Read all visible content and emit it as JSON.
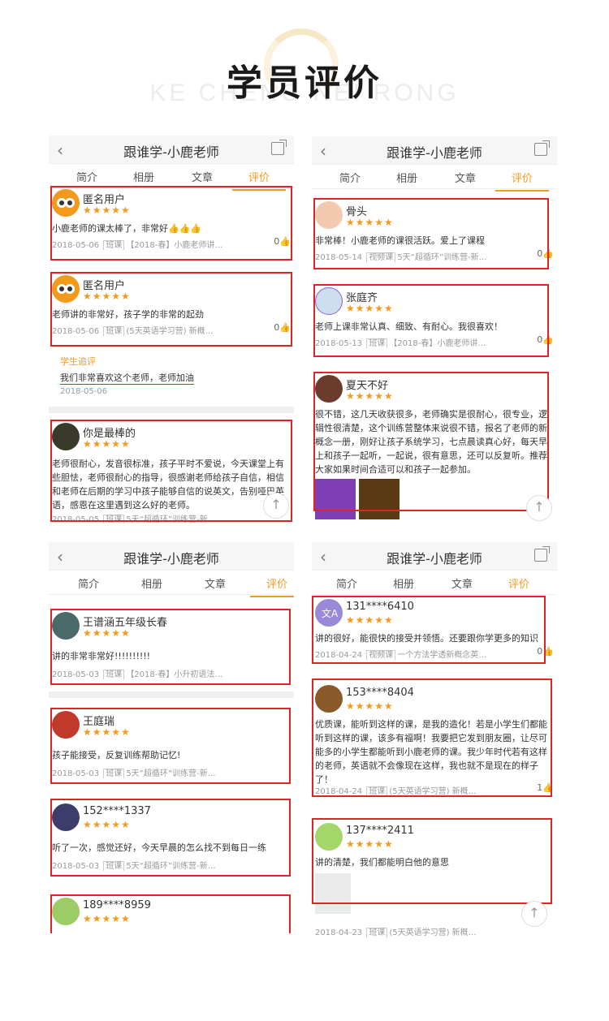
{
  "header": {
    "title": "学员评价",
    "bg_text": "KE CHENG NEI RONG"
  },
  "nav_title": "跟谁学-小鹿老师",
  "tabs": [
    "简介",
    "相册",
    "文章",
    "评价"
  ],
  "colors": {
    "accent": "#f39a1d",
    "highlight": "#e02424"
  },
  "panels": {
    "tl": {
      "reviews": [
        {
          "user": "匿名用户",
          "stars": "★★★★★",
          "text": "小鹿老师的课太棒了，非常好👍👍👍",
          "date": "2018-05-06",
          "tag": "班课",
          "course": "【2018-春】小鹿老师讲…",
          "likes": "0"
        },
        {
          "user": "匿名用户",
          "stars": "★★★★★",
          "text": "老师讲的非常好，孩子学的非常的起劲",
          "date": "2018-05-06",
          "tag": "班课",
          "course": "(5天英语学习营) 新概…",
          "likes": "0"
        },
        {
          "user": "你是最棒的",
          "stars": "★★★★★",
          "text": "老师很耐心，发音很标准，孩子平时不爱说，今天课堂上有些胆怯，老师很耐心的指导，很感谢老师给孩子自信，相信和老师在后期的学习中孩子能够自信的说英文，告别哑巴英语，感恩在这里遇到这么好的老师。",
          "date": "2018-05-05",
          "tag": "班课",
          "course": "5天“超循环”训练营-新…",
          "likes": ""
        }
      ],
      "followup": {
        "label": "学生追评",
        "text": "我们非常喜欢这个老师，老师加油",
        "date": "2018-05-06"
      }
    },
    "tr": {
      "reviews": [
        {
          "user": "骨头",
          "stars": "★★★★★",
          "text": "非常棒！小鹿老师的课很活跃。爱上了课程",
          "date": "2018-05-14",
          "tag": "视频课",
          "course": "5天“超循环”训练营-新…",
          "likes": "0"
        },
        {
          "user": "张庭齐",
          "stars": "★★★★★",
          "text": "老师上课非常认真、细致、有耐心。我很喜欢！",
          "date": "2018-05-13",
          "tag": "班课",
          "course": "【2018-春】小鹿老师讲…",
          "likes": "0"
        },
        {
          "user": "夏天不好",
          "stars": "★★★★★",
          "text": "很不错，这几天收获很多，老师确实是很耐心，很专业，逻辑性很清楚，这个训练营整体来说很不错，报名了老师的新概念一册，刚好让孩子系统学习，七点晨读真心好，每天早上和孩子一起听，一起说，很有意思，还可以反复听。推荐大家如果时间合适可以和孩子一起参加。",
          "date": "",
          "tag": "",
          "course": "",
          "likes": ""
        }
      ]
    },
    "bl": {
      "reviews": [
        {
          "user": "王谱涵五年级长春",
          "stars": "★★★★★",
          "text": "讲的非常非常好!!!!!!!!!!",
          "date": "2018-05-03",
          "tag": "班课",
          "course": "【2018-春】小升初语法…",
          "likes": ""
        },
        {
          "user": "王庭瑞",
          "stars": "★★★★★",
          "text": "孩子能接受，反复训练帮助记忆!",
          "date": "2018-05-03",
          "tag": "班课",
          "course": "5天“超循环”训练营-新…",
          "likes": ""
        },
        {
          "user": "152****1337",
          "stars": "★★★★★",
          "text": "听了一次，感觉还好，今天早晨的怎么找不到每日一练",
          "date": "2018-05-03",
          "tag": "班课",
          "course": "5天“超循环”训练营-新…",
          "likes": ""
        },
        {
          "user": "189****8959",
          "stars": "★★★★★",
          "text": "",
          "date": "",
          "tag": "",
          "course": "",
          "likes": ""
        }
      ]
    },
    "br": {
      "reviews": [
        {
          "user": "131****6410",
          "stars": "★★★★★",
          "text": "讲的很好，能很快的接受并领悟。还要跟你学更多的知识",
          "date": "2018-04-24",
          "tag": "视频课",
          "course": "一个方法学透新概念英…",
          "likes": "0"
        },
        {
          "user": "153****8404",
          "stars": "★★★★★",
          "text": "优质课，能听到这样的课，是我的造化！若是小学生们都能听到这样的课，该多有福啊！我要把它发到朋友圈，让尽可能多的小学生都能听到小鹿老师的课。我少年时代若有这样的老师，英语就不会像现在这样，我也就不是现在的样子了！",
          "date": "2018-04-24",
          "tag": "班课",
          "course": "(5天英语学习营) 新概…",
          "likes": "1"
        },
        {
          "user": "137****2411",
          "stars": "★★★★★",
          "text": "讲的清楚，我们都能明白他的意思",
          "date": "2018-04-23",
          "tag": "班课",
          "course": "(5天英语学习营) 新概…",
          "likes": ""
        }
      ]
    }
  }
}
